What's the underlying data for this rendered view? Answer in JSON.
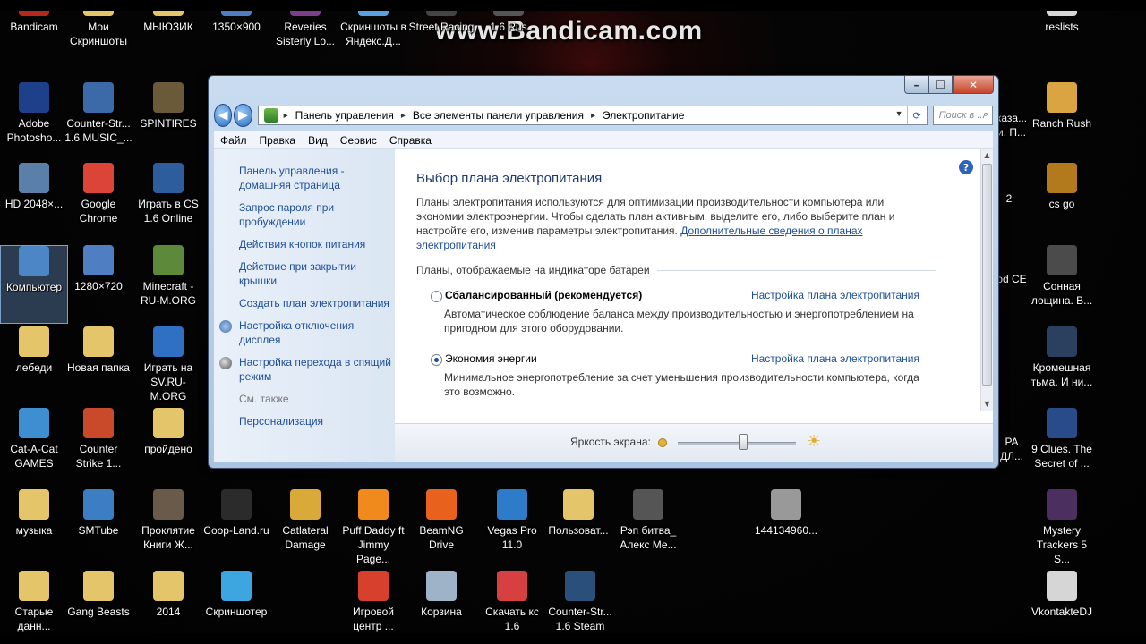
{
  "watermark": "www.Bandicam.com",
  "desktop_icons": [
    {
      "label": "Bandicam",
      "icon": "bandicam-icon",
      "color": "#b8271b"
    },
    {
      "label": "Мои Скриншоты",
      "icon": "folder-icon",
      "color": "#e5c56a"
    },
    {
      "label": "МЫЮЗИК",
      "icon": "folder-icon",
      "color": "#e5c56a"
    },
    {
      "label": "1350×900",
      "icon": "image-file-icon",
      "color": "#4f7fc2"
    },
    {
      "label": "Reveries Sisterly Lo...",
      "icon": "game-icon",
      "color": "#7a3e8a"
    },
    {
      "label": "Скриншоты в Яндекс.Д...",
      "icon": "yandex-disk-icon",
      "color": "#5aa0df"
    },
    {
      "label": "Street Racing",
      "icon": "game-icon",
      "color": "#444"
    },
    {
      "label": "1.6 Rus",
      "icon": "counter-strike-icon",
      "color": "#555"
    },
    {
      "label": "reslists",
      "icon": "file-icon",
      "color": "#d6d6d6"
    },
    {
      "label": "Adobe Photosho...",
      "icon": "photoshop-icon",
      "color": "#1e3f8a"
    },
    {
      "label": "Counter-Str... 1.6 MUSIC_...",
      "icon": "counter-strike-icon",
      "color": "#3c6aa8"
    },
    {
      "label": "SPINTIRES",
      "icon": "game-icon",
      "color": "#6b5a3a"
    },
    {
      "label": "Ranch Rush",
      "icon": "game-icon",
      "color": "#d9a441"
    },
    {
      "label": "HD 2048×...",
      "icon": "image-file-icon",
      "color": "#5a7fa8"
    },
    {
      "label": "Google Chrome",
      "icon": "chrome-icon",
      "color": "#db4437"
    },
    {
      "label": "Играть в CS 1.6 Online",
      "icon": "counter-strike-icon",
      "color": "#2d5d9c"
    },
    {
      "label": "cs go",
      "icon": "csgo-icon",
      "color": "#b37a1d"
    },
    {
      "label": "Компьютер",
      "icon": "computer-icon",
      "color": "#4d86c7"
    },
    {
      "label": "1280×720",
      "icon": "image-file-icon",
      "color": "#4f7fc2"
    },
    {
      "label": "Minecraft - RU-M.ORG",
      "icon": "minecraft-icon",
      "color": "#5d8a3a"
    },
    {
      "label": "Сонная лощина. В...",
      "icon": "game-icon",
      "color": "#4b4b4b"
    },
    {
      "label": "лебеди",
      "icon": "folder-icon",
      "color": "#e5c56a"
    },
    {
      "label": "Новая папка",
      "icon": "folder-icon",
      "color": "#e5c56a"
    },
    {
      "label": "Играть на SV.RU-M.ORG",
      "icon": "launcher-icon",
      "color": "#2f6fc4"
    },
    {
      "label": "Кромешная тьма. И ни...",
      "icon": "game-icon",
      "color": "#2b3f5e"
    },
    {
      "label": "Cat-A-Cat GAMES",
      "icon": "game-icon",
      "color": "#3d8fd1"
    },
    {
      "label": "Counter Strike 1...",
      "icon": "counter-strike-icon",
      "color": "#c94a2a"
    },
    {
      "label": "пройдено",
      "icon": "folder-icon",
      "color": "#e5c56a"
    },
    {
      "label": "9 Clues. The Secret of ...",
      "icon": "game-icon",
      "color": "#2a4b8a"
    },
    {
      "label": "музыка",
      "icon": "folder-icon",
      "color": "#e5c56a"
    },
    {
      "label": "SMTube",
      "icon": "smtube-icon",
      "color": "#3b7ec4"
    },
    {
      "label": "Проклятие Книги Ж...",
      "icon": "game-icon",
      "color": "#6a5a4a"
    },
    {
      "label": "Coop-Land.ru",
      "icon": "coopland-icon",
      "color": "#2b2b2b"
    },
    {
      "label": "Catlateral Damage",
      "icon": "game-icon",
      "color": "#d9a93a"
    },
    {
      "label": "Puff Daddy ft Jimmy Page...",
      "icon": "vlc-icon",
      "color": "#f08a1c"
    },
    {
      "label": "BeamNG Drive",
      "icon": "beamng-icon",
      "color": "#e8621d"
    },
    {
      "label": "Vegas Pro 11.0",
      "icon": "vegas-icon",
      "color": "#2d7bc9"
    },
    {
      "label": "Пользоват...",
      "icon": "user-folder-icon",
      "color": "#e5c56a"
    },
    {
      "label": "Рэп битва_ Алекс Ме...",
      "icon": "video-file-icon",
      "color": "#555"
    },
    {
      "label": "144134960...",
      "icon": "image-file-icon",
      "color": "#999"
    },
    {
      "label": "Mystery Trackers 5 S...",
      "icon": "game-icon",
      "color": "#4b2f5e"
    },
    {
      "label": "Старые данн...",
      "icon": "folder-icon",
      "color": "#e5c56a"
    },
    {
      "label": "Gang Beasts",
      "icon": "game-icon",
      "color": "#e5c56a"
    },
    {
      "label": "2014",
      "icon": "folder-icon",
      "color": "#e5c56a"
    },
    {
      "label": "Скриншотер",
      "icon": "screenshoter-icon",
      "color": "#3da5e0"
    },
    {
      "label": "Игровой центр ...",
      "icon": "game-center-icon",
      "color": "#d6402c"
    },
    {
      "label": "Корзина",
      "icon": "recycle-bin-icon",
      "color": "#9fb3c8"
    },
    {
      "label": "Скачать кс 1.6",
      "icon": "download-icon",
      "color": "#d64040"
    },
    {
      "label": "Counter-Str... 1.6 Steam",
      "icon": "counter-strike-icon",
      "color": "#2a4f7a"
    },
    {
      "label": "VkontakteDJ",
      "icon": "file-icon",
      "color": "#d6d6d6"
    }
  ],
  "partial_labels": {
    "right_a": "каза... и. П...",
    "right_b": "2",
    "right_c": "od CE",
    "right_d": "PA ДЛ..."
  },
  "window": {
    "close_glyph": "✕",
    "max_glyph": "☐",
    "min_glyph": "–",
    "back_glyph": "◀",
    "forward_glyph": "▶",
    "breadcrumbs": [
      "Панель управления",
      "Все элементы панели управления",
      "Электропитание"
    ],
    "breadcrumb_sep": "▸",
    "search_placeholder": "Поиск в ...",
    "menu": [
      "Файл",
      "Правка",
      "Вид",
      "Сервис",
      "Справка"
    ],
    "left_links": [
      {
        "label": "Панель управления - домашняя страница",
        "icon": null
      },
      {
        "label": "Запрос пароля при пробуждении",
        "icon": null
      },
      {
        "label": "Действия кнопок питания",
        "icon": null
      },
      {
        "label": "Действие при закрытии крышки",
        "icon": null
      },
      {
        "label": "Создать план электропитания",
        "icon": null
      },
      {
        "label": "Настройка отключения дисплея",
        "icon": "display-icon"
      },
      {
        "label": "Настройка перехода в спящий режим",
        "icon": "moon-icon"
      }
    ],
    "see_also": "См. также",
    "personalization": "Персонализация",
    "help_glyph": "?",
    "title": "Выбор плана электропитания",
    "description": "Планы электропитания используются для оптимизации производительности компьютера или экономии электроэнергии. Чтобы сделать план активным, выделите его, либо выберите план и настройте его, изменив параметры электропитания.",
    "more_link": "Дополнительные сведения о планах электропитания",
    "group_header": "Планы, отображаемые на индикаторе батареи",
    "plans": [
      {
        "name": "Сбалансированный (рекомендуется)",
        "selected": false,
        "config": "Настройка плана электропитания",
        "description": "Автоматическое соблюдение баланса между производительностью и энергопотреблением на пригодном для этого оборудовании."
      },
      {
        "name": "Экономия энергии",
        "selected": true,
        "config": "Настройка плана электропитания",
        "description": "Минимальное энергопотребление за счет уменьшения производительности компьютера, когда это возможно."
      }
    ],
    "brightness_label": "Яркость экрана:",
    "brightness_level": 0.55
  },
  "colors": {
    "link": "#1e4f98",
    "heading": "#1e3b6e",
    "close_button": "#c7442a"
  }
}
